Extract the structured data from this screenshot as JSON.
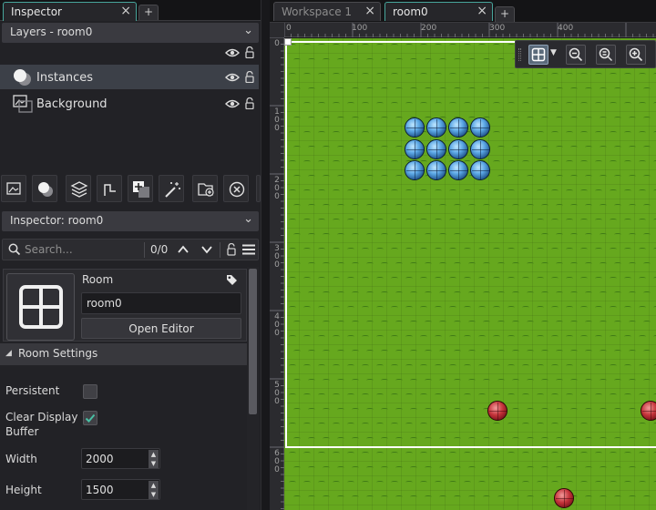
{
  "left_panel": {
    "tab": {
      "label": "Inspector"
    },
    "layers_dropdown": {
      "label": "Layers - room0"
    },
    "layers": [
      {
        "label": "Instances",
        "icon": "instance-layer-icon",
        "selected": true
      },
      {
        "label": "Background",
        "icon": "background-layer-icon",
        "selected": false
      }
    ],
    "inspector_dropdown": {
      "label": "Inspector: room0"
    },
    "search": {
      "placeholder": "Search...",
      "count": "0/0"
    },
    "room_card": {
      "title": "Room",
      "name_value": "room0",
      "open_editor_label": "Open Editor"
    },
    "room_settings": {
      "header": "Room Settings",
      "persistent_label": "Persistent",
      "persistent_checked": false,
      "clear_display_label_1": "Clear Display",
      "clear_display_label_2": "Buffer",
      "clear_display_checked": true,
      "width_label": "Width",
      "width_value": "2000",
      "height_label": "Height",
      "height_value": "1500"
    }
  },
  "editor": {
    "tabs": [
      {
        "label": "Workspace 1",
        "active": false
      },
      {
        "label": "room0",
        "active": true
      }
    ],
    "ruler_x_labels": [
      "0",
      "100",
      "200",
      "300",
      "400"
    ],
    "ruler_y_labels": [
      "0",
      "100",
      "200",
      "300",
      "400",
      "500",
      "600"
    ]
  },
  "colors": {
    "accent": "#47a59b",
    "grass": "#66a81e",
    "instance_blue": "#3d86c6",
    "instance_red": "#b52b33"
  }
}
